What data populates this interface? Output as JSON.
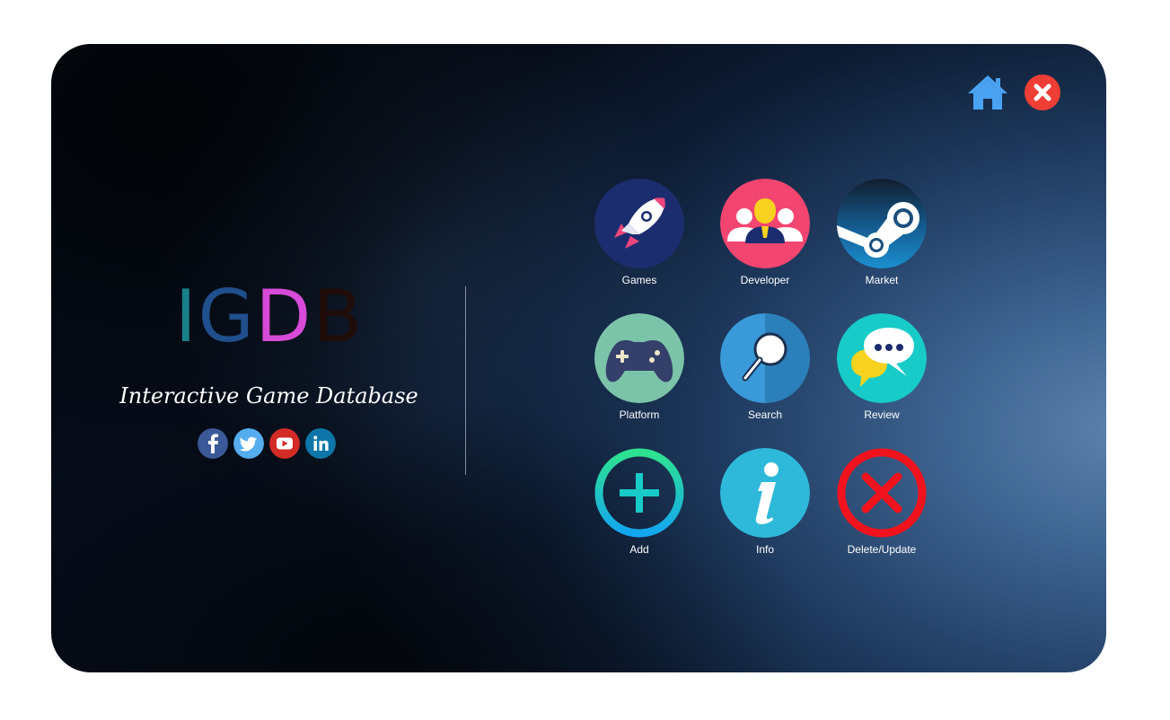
{
  "app": {
    "logo": {
      "letters": [
        "I",
        "G",
        "D",
        "B"
      ],
      "colors": [
        "#17808a",
        "#1f4f8c",
        "#d84ad8",
        "#200c08"
      ]
    },
    "subtitle": "Interactive Game Database"
  },
  "window_controls": {
    "home_icon": "home-icon",
    "close_icon": "close-icon"
  },
  "socials": [
    {
      "name": "facebook",
      "icon": "facebook-icon",
      "glyph": "f",
      "color": "#3b5998"
    },
    {
      "name": "twitter",
      "icon": "twitter-icon",
      "glyph": "t",
      "color": "#55acee"
    },
    {
      "name": "youtube",
      "icon": "youtube-icon",
      "glyph": "▶",
      "color": "#d32b26"
    },
    {
      "name": "linkedin",
      "icon": "linkedin-icon",
      "glyph": "in",
      "color": "#0e76a8"
    }
  ],
  "menu": {
    "games": {
      "label": "Games",
      "icon": "rocket-icon"
    },
    "developer": {
      "label": "Developer",
      "icon": "team-icon"
    },
    "market": {
      "label": "Market",
      "icon": "steam-icon"
    },
    "platform": {
      "label": "Platform",
      "icon": "gamepad-icon"
    },
    "search": {
      "label": "Search",
      "icon": "magnifier-icon"
    },
    "review": {
      "label": "Review",
      "icon": "chat-bubbles-icon"
    },
    "add": {
      "label": "Add",
      "icon": "plus-circle-icon"
    },
    "info": {
      "label": "Info",
      "icon": "info-icon"
    },
    "delete_update": {
      "label": "Delete/Update",
      "icon": "x-circle-icon"
    }
  }
}
